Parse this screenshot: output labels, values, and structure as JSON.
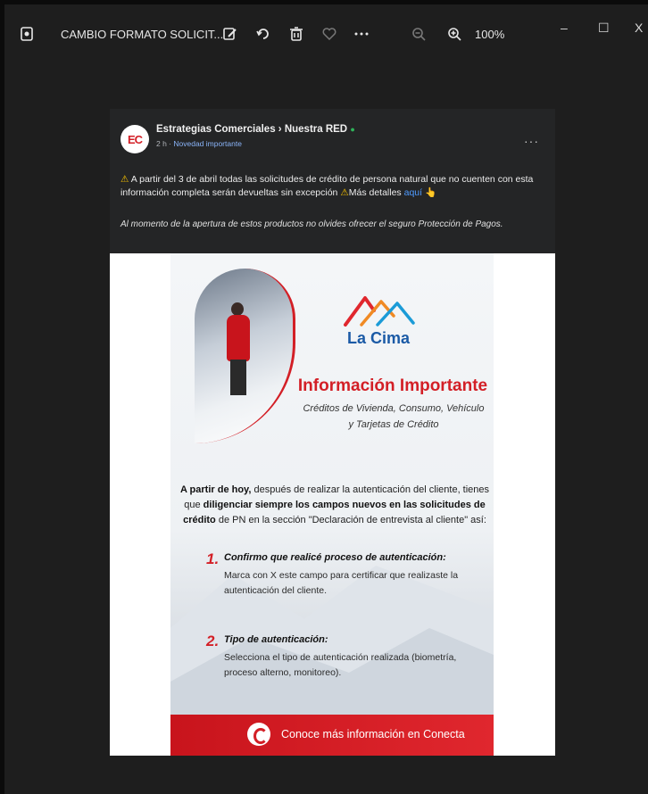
{
  "titlebar": {
    "title": "CAMBIO FORMATO SOLICIT...",
    "zoom": "100%",
    "icons": [
      "document-icon",
      "edit-icon",
      "rotate-icon",
      "trash-icon",
      "heart-icon",
      "more-icon",
      "zoom-out-icon",
      "zoom-in-icon"
    ],
    "window_controls": {
      "minimize": "–",
      "maximize": "☐",
      "close": "X"
    }
  },
  "post": {
    "avatar_text": "EC",
    "page_name": "Estrategias Comerciales › Nuestra RED",
    "verified_mark": "●",
    "time": "2 h · ",
    "tag": "Novedad importante",
    "body_before": " A partir del 3 de abril todas las solicitudes de crédito de persona natural que no cuenten con esta información completa serán devueltas sin excepción ",
    "body_after": "Más detalles ",
    "link_text": "aquí",
    "warning_glyph": "⚠",
    "pointer_glyph": "👆",
    "italic_note": "Al momento de la apertura de estos productos no olvides ofrecer el seguro Protección de Pagos.",
    "more": "···"
  },
  "poster": {
    "brand": "La Cima",
    "headline": "Información Importante",
    "subtitle_line1": "Créditos de Vivienda, Consumo, Vehículo",
    "subtitle_line2": "y Tarjetas de Crédito",
    "intro_bold1": "A partir de hoy,",
    "intro_text1": " después de realizar la autenticación del cliente, tienes que ",
    "intro_bold2": "diligenciar siempre los campos nuevos en las solicitudes de crédito",
    "intro_text2": " de PN en la sección \"Declaración de entrevista al cliente\" así:",
    "items": [
      {
        "num": "1.",
        "title": "Confirmo que realicé proceso de autenticación:",
        "desc": "Marca con X este campo para certificar que realizaste la autenticación del cliente."
      },
      {
        "num": "2.",
        "title": "Tipo de autenticación:",
        "desc": "Selecciona el tipo de autenticación realizada (biometría, proceso alterno, monitoreo)."
      }
    ],
    "banner_text": "Conoce más información en Conecta"
  },
  "colors": {
    "brand_red": "#d31f26",
    "brand_blue": "#1b5aa6",
    "link": "#4f9bff",
    "warning": "#f7c200"
  }
}
